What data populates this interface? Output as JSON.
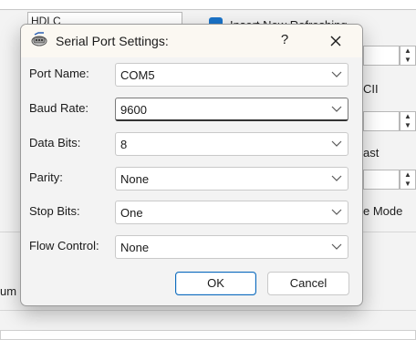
{
  "background": {
    "fragments": {
      "top_left_label": "HDLC",
      "checkbox_label": "Insert New Refreshing",
      "ascii_label": "CII",
      "last_label": "ast",
      "mode_label": "e Mode",
      "bottom_left_label": "um B"
    }
  },
  "dialog": {
    "title": "Serial Port Settings:",
    "help_label": "?",
    "icon": "serial-port-app-icon",
    "fields": [
      {
        "label": "Port Name:",
        "value": "COM5"
      },
      {
        "label": "Baud Rate:",
        "value": "9600"
      },
      {
        "label": "Data Bits:",
        "value": "8"
      },
      {
        "label": "Parity:",
        "value": "None"
      },
      {
        "label": "Stop Bits:",
        "value": "One"
      },
      {
        "label": "Flow Control:",
        "value": "None"
      }
    ],
    "ok_label": "OK",
    "cancel_label": "Cancel"
  },
  "colors": {
    "accent": "#0f6cbd",
    "checkbox": "#1a73c9",
    "dialog_bg": "#f3f3f3",
    "titlebar_bg": "#fbf8f2"
  }
}
